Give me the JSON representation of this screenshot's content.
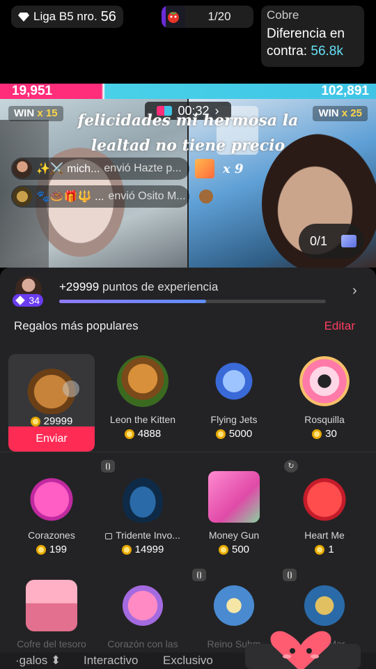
{
  "top": {
    "league_label": "Liga B5 nro.",
    "league_number": "56",
    "round": "1/20",
    "cobre_title": "Cobre",
    "diff_label": "Diferencia en contra:",
    "diff_value": "56.8k"
  },
  "battle": {
    "left_score": "19,951",
    "right_score": "102,891",
    "left_win": "WIN",
    "left_win_count": "x 15",
    "right_win": "WIN",
    "right_win_count": "x 25",
    "timer": "00:32",
    "message_line1": "felicidades mi hermosa la",
    "message_line2": "lealtad no tiene precio",
    "gift_events": [
      {
        "name": "✨⚔️ mich...",
        "sent": "envió Hazte p...",
        "combo": "x 9"
      },
      {
        "name": "🐾🍩🎁🔱 ...",
        "sent": "envió Osito M..."
      }
    ],
    "counter": "0/1"
  },
  "panel": {
    "xp_text_bold": "+29999",
    "xp_text": "puntos de experiencia",
    "xp_progress": 0.55,
    "level": "34",
    "section_title": "Regalos más populares",
    "edit_label": "Editar",
    "selected_gift": {
      "price": "29999",
      "send_label": "Enviar"
    },
    "gifts_row1": [
      {
        "name": "Leon the Kitten",
        "price": "4888"
      },
      {
        "name": "Flying Jets",
        "price": "5000"
      },
      {
        "name": "Rosquilla",
        "price": "30"
      }
    ],
    "gifts_row2": [
      {
        "name": "Corazones",
        "price": "199"
      },
      {
        "name": "Tridente Invo...",
        "price": "14999"
      },
      {
        "name": "Money Gun",
        "price": "500"
      },
      {
        "name": "Heart Me",
        "price": "1"
      }
    ],
    "gifts_row3": [
      {
        "name": "Cofre del tesoro"
      },
      {
        "name": "Corazón con las"
      },
      {
        "name": "Reino Subm"
      },
      {
        "name": "... de Mar"
      }
    ],
    "tabs": [
      "·galos ⬍",
      "Interactivo",
      "Exclusivo"
    ]
  }
}
